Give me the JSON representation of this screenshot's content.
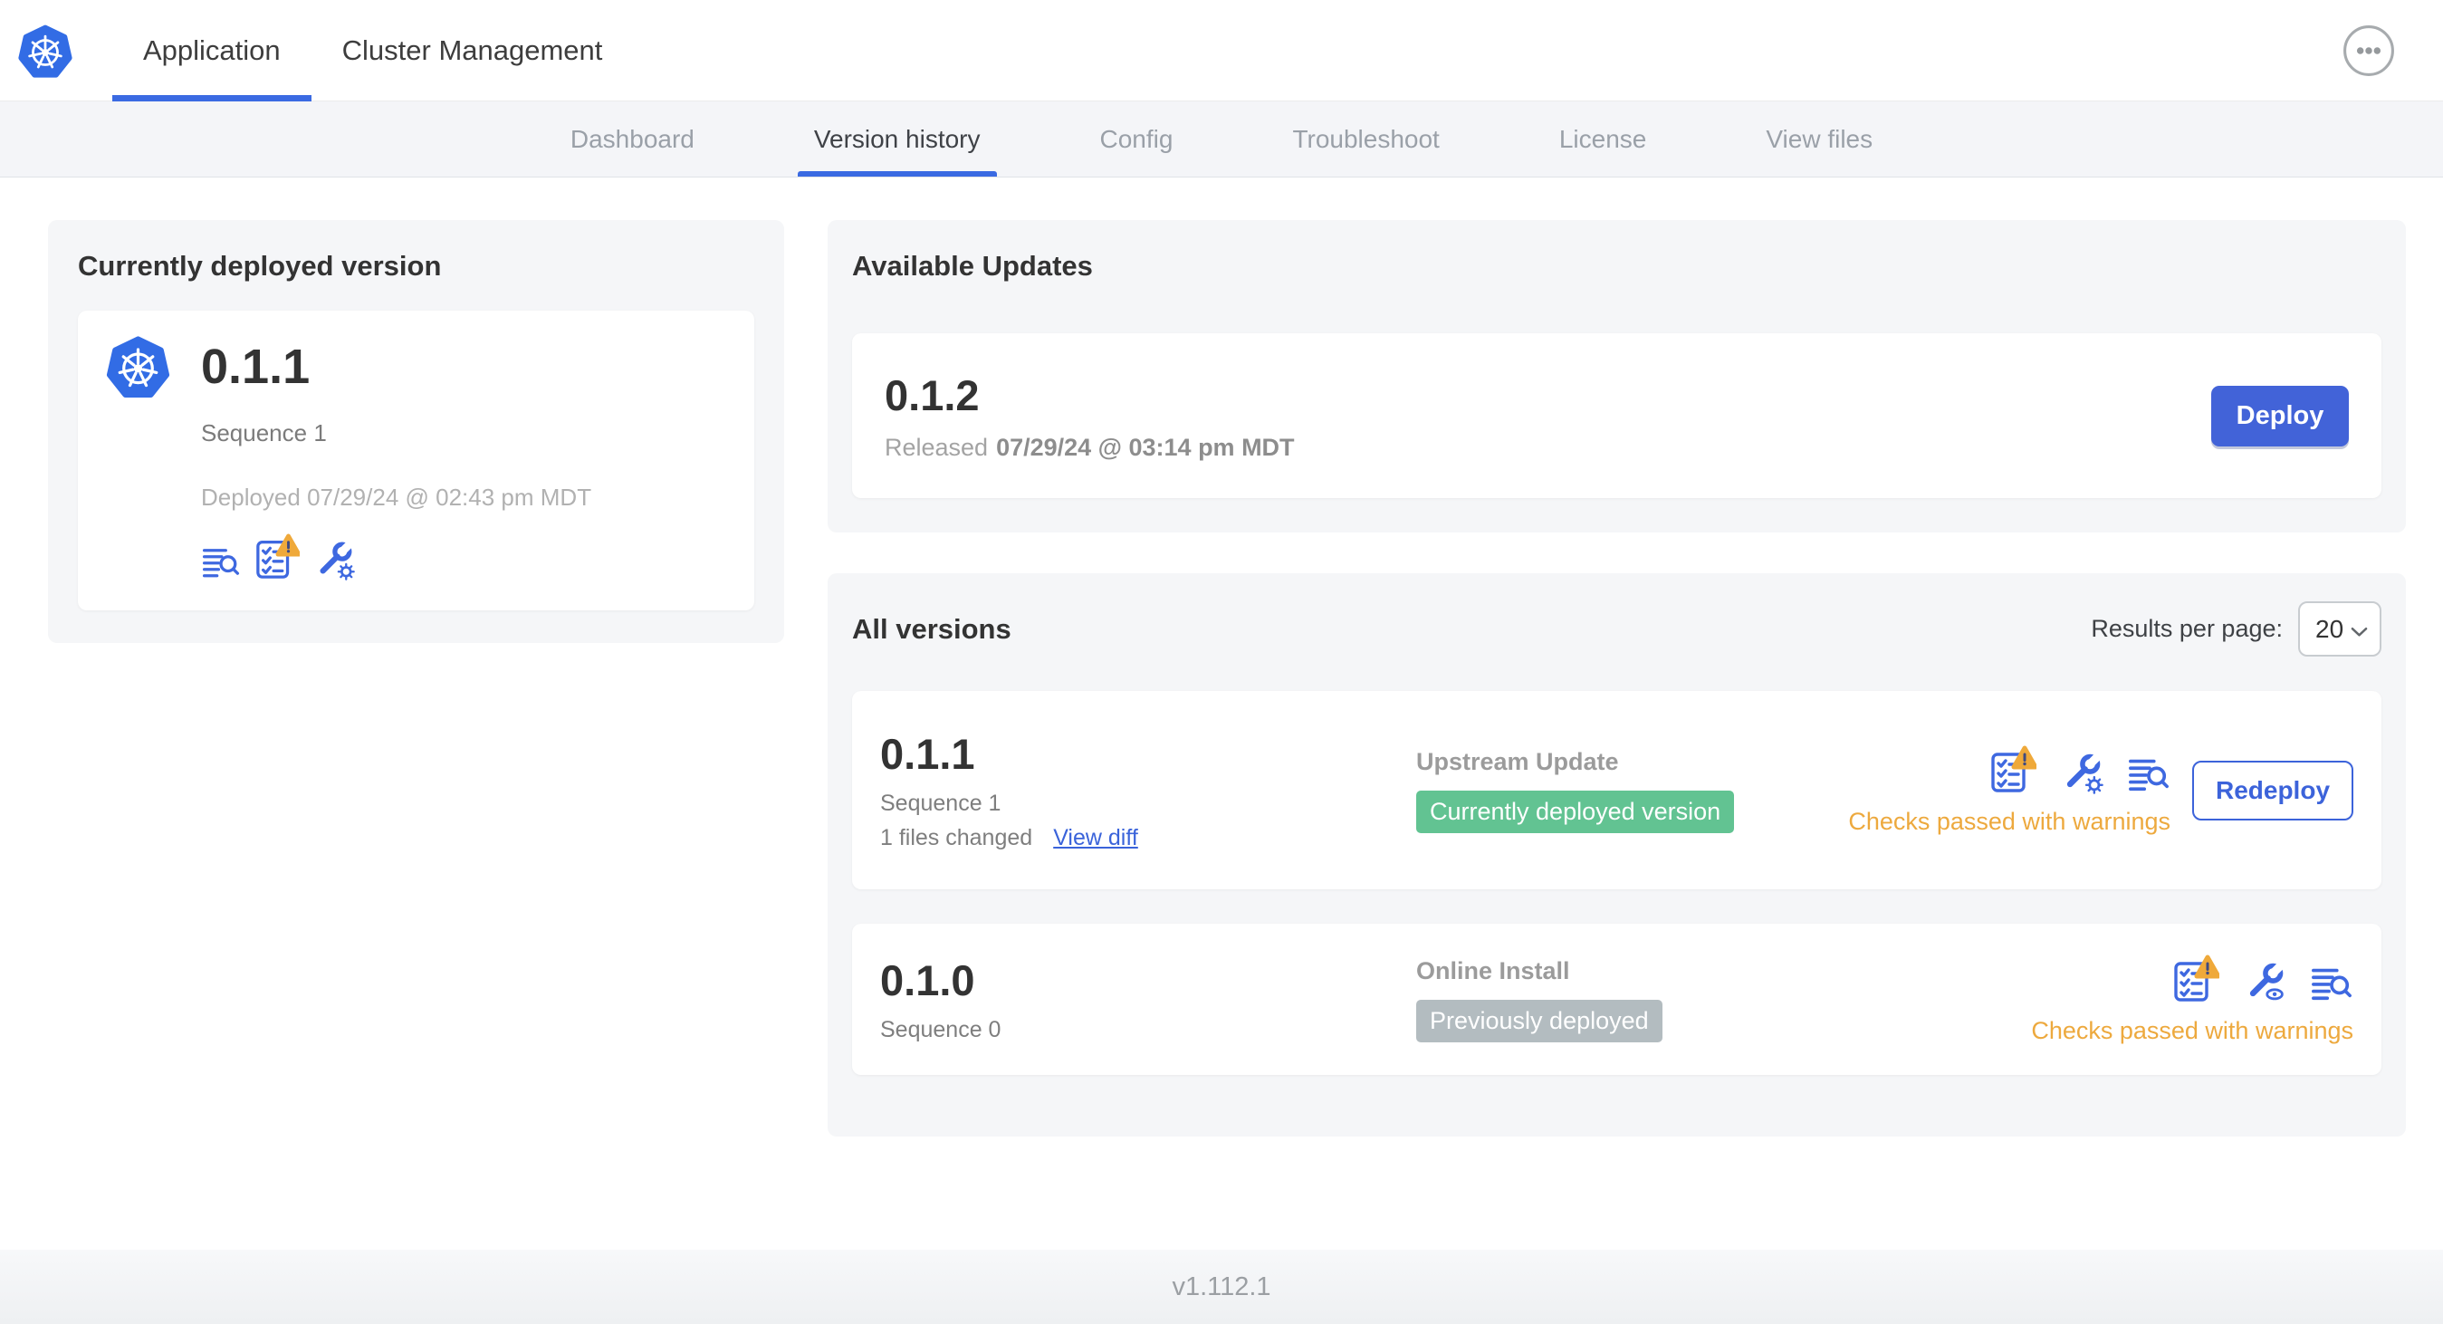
{
  "header": {
    "tabs": [
      {
        "label": "Application",
        "active": true
      },
      {
        "label": "Cluster Management",
        "active": false
      }
    ],
    "menu_icon": "ellipsis-circle-icon"
  },
  "subnav": {
    "items": [
      {
        "label": "Dashboard",
        "active": false
      },
      {
        "label": "Version history",
        "active": true
      },
      {
        "label": "Config",
        "active": false
      },
      {
        "label": "Troubleshoot",
        "active": false
      },
      {
        "label": "License",
        "active": false
      },
      {
        "label": "View files",
        "active": false
      }
    ]
  },
  "current_version_card": {
    "title": "Currently deployed version",
    "version": "0.1.1",
    "sequence": "Sequence 1",
    "deployed": "Deployed 07/29/24 @ 02:43 pm MDT",
    "icons": [
      "diff-lines-magnifier-icon",
      "preflight-checklist-warning-icon",
      "config-wrench-gear-icon"
    ]
  },
  "available_updates": {
    "title": "Available Updates",
    "version": "0.1.2",
    "released_prefix": "Released",
    "released_date": "07/29/24 @ 03:14 pm MDT",
    "deploy_label": "Deploy"
  },
  "all_versions": {
    "title": "All versions",
    "results_per_page_label": "Results per page:",
    "results_per_page_value": "20",
    "rows": [
      {
        "version": "0.1.1",
        "sequence": "Sequence 1",
        "files_changed": "1 files changed",
        "view_diff_label": "View diff",
        "source": "Upstream Update",
        "badge": "Currently deployed version",
        "badge_color": "#62c392",
        "icons": [
          "preflight-checklist-warning-icon",
          "config-wrench-gear-icon",
          "diff-lines-magnifier-icon"
        ],
        "status": "Checks passed with warnings",
        "action_label": "Redeploy"
      },
      {
        "version": "0.1.0",
        "sequence": "Sequence 0",
        "source": "Online Install",
        "badge": "Previously deployed",
        "badge_color": "#b3bcc0",
        "icons": [
          "preflight-checklist-warning-icon",
          "config-wrench-eye-icon",
          "diff-lines-magnifier-icon"
        ],
        "status": "Checks passed with warnings"
      }
    ]
  },
  "footer": {
    "version": "v1.112.1"
  },
  "colors": {
    "primary_blue": "#3a6ae2",
    "k8s_logo_blue": "#326ce5",
    "success_green": "#62c392",
    "muted_badge_gray": "#b3bcc0",
    "warning_orange": "#eda93e"
  }
}
